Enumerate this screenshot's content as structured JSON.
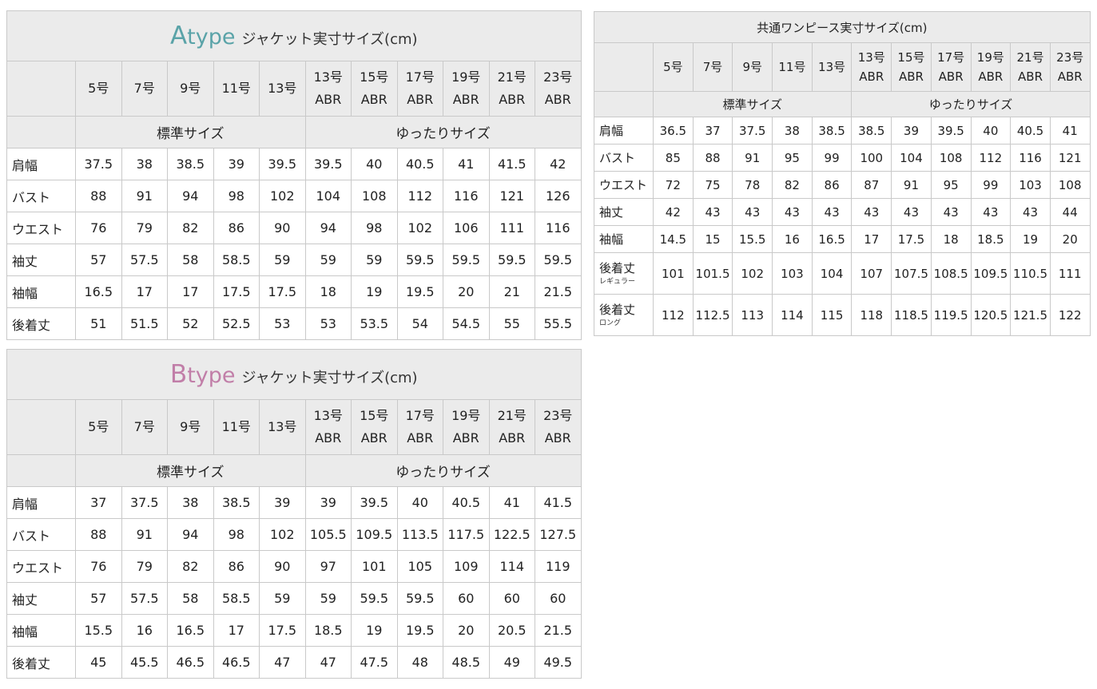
{
  "colors": {
    "atype_accent": "#5aa3a8",
    "btype_accent": "#c17ea8",
    "header_bg": "#ebebeb",
    "border": "#c9c9c9"
  },
  "sizes_jacket": [
    [
      "5号"
    ],
    [
      "7号"
    ],
    [
      "9号"
    ],
    [
      "11号"
    ],
    [
      "13号"
    ],
    [
      "13号",
      "ABR"
    ],
    [
      "15号",
      "ABR"
    ],
    [
      "17号",
      "ABR"
    ],
    [
      "19号",
      "ABR"
    ],
    [
      "21号",
      "ABR"
    ],
    [
      "23号",
      "ABR"
    ]
  ],
  "groups": {
    "standard": "標準サイズ",
    "relaxed": "ゆったりサイズ"
  },
  "atype": {
    "title_letter": "A",
    "title_word": "type",
    "title_suffix": "ジャケット実寸サイズ(cm)",
    "rows": [
      {
        "label": "肩幅",
        "values": [
          "37.5",
          "38",
          "38.5",
          "39",
          "39.5",
          "39.5",
          "40",
          "40.5",
          "41",
          "41.5",
          "42"
        ]
      },
      {
        "label": "バスト",
        "values": [
          "88",
          "91",
          "94",
          "98",
          "102",
          "104",
          "108",
          "112",
          "116",
          "121",
          "126"
        ]
      },
      {
        "label": "ウエスト",
        "values": [
          "76",
          "79",
          "82",
          "86",
          "90",
          "94",
          "98",
          "102",
          "106",
          "111",
          "116"
        ]
      },
      {
        "label": "袖丈",
        "values": [
          "57",
          "57.5",
          "58",
          "58.5",
          "59",
          "59",
          "59",
          "59.5",
          "59.5",
          "59.5",
          "59.5"
        ]
      },
      {
        "label": "袖幅",
        "values": [
          "16.5",
          "17",
          "17",
          "17.5",
          "17.5",
          "18",
          "19",
          "19.5",
          "20",
          "21",
          "21.5"
        ]
      },
      {
        "label": "後着丈",
        "values": [
          "51",
          "51.5",
          "52",
          "52.5",
          "53",
          "53",
          "53.5",
          "54",
          "54.5",
          "55",
          "55.5"
        ]
      }
    ]
  },
  "btype": {
    "title_letter": "B",
    "title_word": "type",
    "title_suffix": "ジャケット実寸サイズ(cm)",
    "rows": [
      {
        "label": "肩幅",
        "values": [
          "37",
          "37.5",
          "38",
          "38.5",
          "39",
          "39",
          "39.5",
          "40",
          "40.5",
          "41",
          "41.5"
        ]
      },
      {
        "label": "バスト",
        "values": [
          "88",
          "91",
          "94",
          "98",
          "102",
          "105.5",
          "109.5",
          "113.5",
          "117.5",
          "122.5",
          "127.5"
        ]
      },
      {
        "label": "ウエスト",
        "values": [
          "76",
          "79",
          "82",
          "86",
          "90",
          "97",
          "101",
          "105",
          "109",
          "114",
          "119"
        ]
      },
      {
        "label": "袖丈",
        "values": [
          "57",
          "57.5",
          "58",
          "58.5",
          "59",
          "59",
          "59.5",
          "59.5",
          "60",
          "60",
          "60"
        ]
      },
      {
        "label": "袖幅",
        "values": [
          "15.5",
          "16",
          "16.5",
          "17",
          "17.5",
          "18.5",
          "19",
          "19.5",
          "20",
          "20.5",
          "21.5"
        ]
      },
      {
        "label": "後着丈",
        "values": [
          "45",
          "45.5",
          "46.5",
          "46.5",
          "47",
          "47",
          "47.5",
          "48",
          "48.5",
          "49",
          "49.5"
        ]
      }
    ]
  },
  "onepiece": {
    "title": "共通ワンピース実寸サイズ(cm)",
    "sizes": [
      [
        "5号"
      ],
      [
        "7号"
      ],
      [
        "9号"
      ],
      [
        "11号"
      ],
      [
        "13号"
      ],
      [
        "13号",
        "ABR"
      ],
      [
        "15号",
        "ABR"
      ],
      [
        "17号",
        "ABR"
      ],
      [
        "19号",
        "ABR"
      ],
      [
        "21号",
        "ABR"
      ],
      [
        "23号",
        "ABR"
      ]
    ],
    "rows": [
      {
        "label": "肩幅",
        "sub": "",
        "values": [
          "36.5",
          "37",
          "37.5",
          "38",
          "38.5",
          "38.5",
          "39",
          "39.5",
          "40",
          "40.5",
          "41"
        ]
      },
      {
        "label": "バスト",
        "sub": "",
        "values": [
          "85",
          "88",
          "91",
          "95",
          "99",
          "100",
          "104",
          "108",
          "112",
          "116",
          "121"
        ]
      },
      {
        "label": "ウエスト",
        "sub": "",
        "values": [
          "72",
          "75",
          "78",
          "82",
          "86",
          "87",
          "91",
          "95",
          "99",
          "103",
          "108"
        ]
      },
      {
        "label": "袖丈",
        "sub": "",
        "values": [
          "42",
          "43",
          "43",
          "43",
          "43",
          "43",
          "43",
          "43",
          "43",
          "43",
          "44"
        ]
      },
      {
        "label": "袖幅",
        "sub": "",
        "values": [
          "14.5",
          "15",
          "15.5",
          "16",
          "16.5",
          "17",
          "17.5",
          "18",
          "18.5",
          "19",
          "20"
        ]
      },
      {
        "label": "後着丈",
        "sub": "レギュラー",
        "values": [
          "101",
          "101.5",
          "102",
          "103",
          "104",
          "107",
          "107.5",
          "108.5",
          "109.5",
          "110.5",
          "111"
        ]
      },
      {
        "label": "後着丈",
        "sub": "ロング",
        "values": [
          "112",
          "112.5",
          "113",
          "114",
          "115",
          "118",
          "118.5",
          "119.5",
          "120.5",
          "121.5",
          "122"
        ]
      }
    ]
  }
}
